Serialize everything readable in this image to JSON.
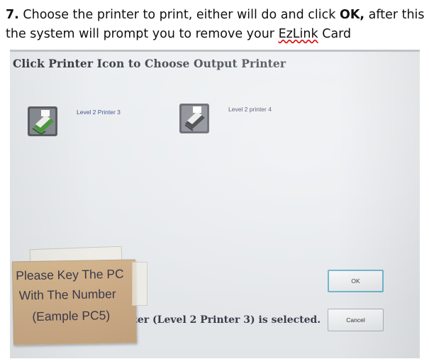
{
  "instruction": {
    "step": "7.",
    "part1": " Choose the printer to print, either will do and click ",
    "ok": "OK,",
    "part2": " after this the system will prompt you to remove your ",
    "brand": "EzLink",
    "part3": " Card"
  },
  "dialog": {
    "title": "Click Printer Icon to Choose Output Printer",
    "printers": [
      {
        "label": "Level 2 Printer 3",
        "icon": "printer-icon-selected"
      },
      {
        "label": "Level 2 printer 4",
        "icon": "printer-icon"
      }
    ],
    "status": "Printer (Level 2 Printer 3) is selected.",
    "ok_label": "OK",
    "cancel_label": "Cancel"
  },
  "sticky_note": {
    "line1": "Please Key The PC",
    "line2": "With The Number",
    "line3": "(Eample PC5)"
  },
  "colors": {
    "selected_printer": "#4a9a3a",
    "ok_border": "#6ab0c8",
    "note": "#cdae88"
  }
}
